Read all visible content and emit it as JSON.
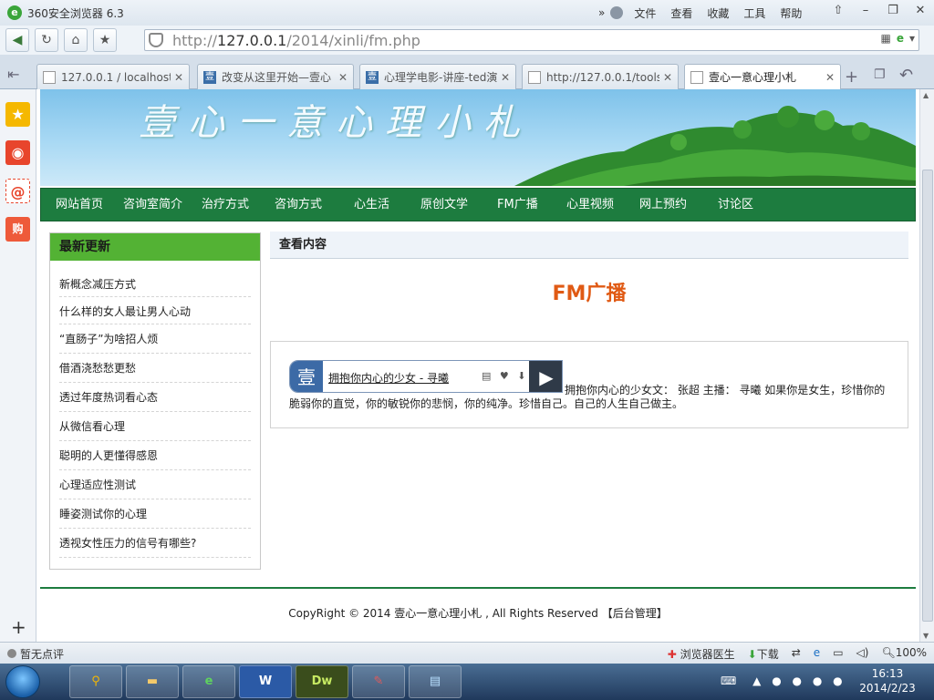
{
  "browser": {
    "title": "360安全浏览器 6.3",
    "menus": [
      "文件",
      "查看",
      "收藏",
      "工具",
      "帮助"
    ],
    "url_host": "127.0.0.1",
    "url_path": "/2014/xinli/fm.php",
    "url_prefix": "http://",
    "tabs": [
      {
        "label": "127.0.0.1 / localhost",
        "icon": "page-icon"
      },
      {
        "label": "改变从这里开始—壹心",
        "icon": "yi-icon"
      },
      {
        "label": "心理学电影-讲座-ted演",
        "icon": "yi-icon"
      },
      {
        "label": "http://127.0.0.1/tools",
        "icon": "page-icon"
      },
      {
        "label": "壹心一意心理小札",
        "icon": "page-icon"
      }
    ]
  },
  "site": {
    "banner_title": "壹心一意心理小札",
    "nav": [
      "网站首页",
      "咨询室简介",
      "治疗方式",
      "咨询方式",
      "心生活",
      "原创文学",
      "FM广播",
      "心里视频",
      "网上预约",
      "讨论区"
    ],
    "sidebar_title": "最新更新",
    "sidebar_items": [
      "新概念减压方式",
      "什么样的女人最让男人心动",
      "“直肠子”为啥招人烦",
      "借酒浇愁愁更愁",
      "透过年度热词看心态",
      "从微信看心理",
      "聪明的人更懂得感恩",
      "心理适应性测试",
      "睡姿测试你的心理",
      "透视女性压力的信号有哪些?"
    ],
    "content_header": "查看内容",
    "content_title": "FM广播",
    "player_logo": "壹",
    "player_title": "拥抱你内心的少女 - 寻曦",
    "article_text": "拥抱你内心的少女文： 张超 主播： 寻曦 如果你是女生，珍惜你的脆弱你的直觉，你的敏锐你的悲悯，你的纯净。珍惜自己。自己的人生自己做主。",
    "footer_copyright": "CopyRight © 2014 壹心一意心理小札 , All Rights Reserved",
    "footer_admin": "【后台管理】"
  },
  "statusbar": {
    "left": "暂无点评",
    "doctor": "浏览器医生",
    "download": "下载",
    "zoom": "100%"
  },
  "taskbar": {
    "time": "16:13",
    "date": "2014/2/23",
    "apps": [
      "search-app",
      "explorer-app",
      "360-browser-app",
      "word-app",
      "dreamweaver-app",
      "notes-app",
      "notepad-app"
    ],
    "dw_label": "Dw",
    "word_label": "W"
  }
}
